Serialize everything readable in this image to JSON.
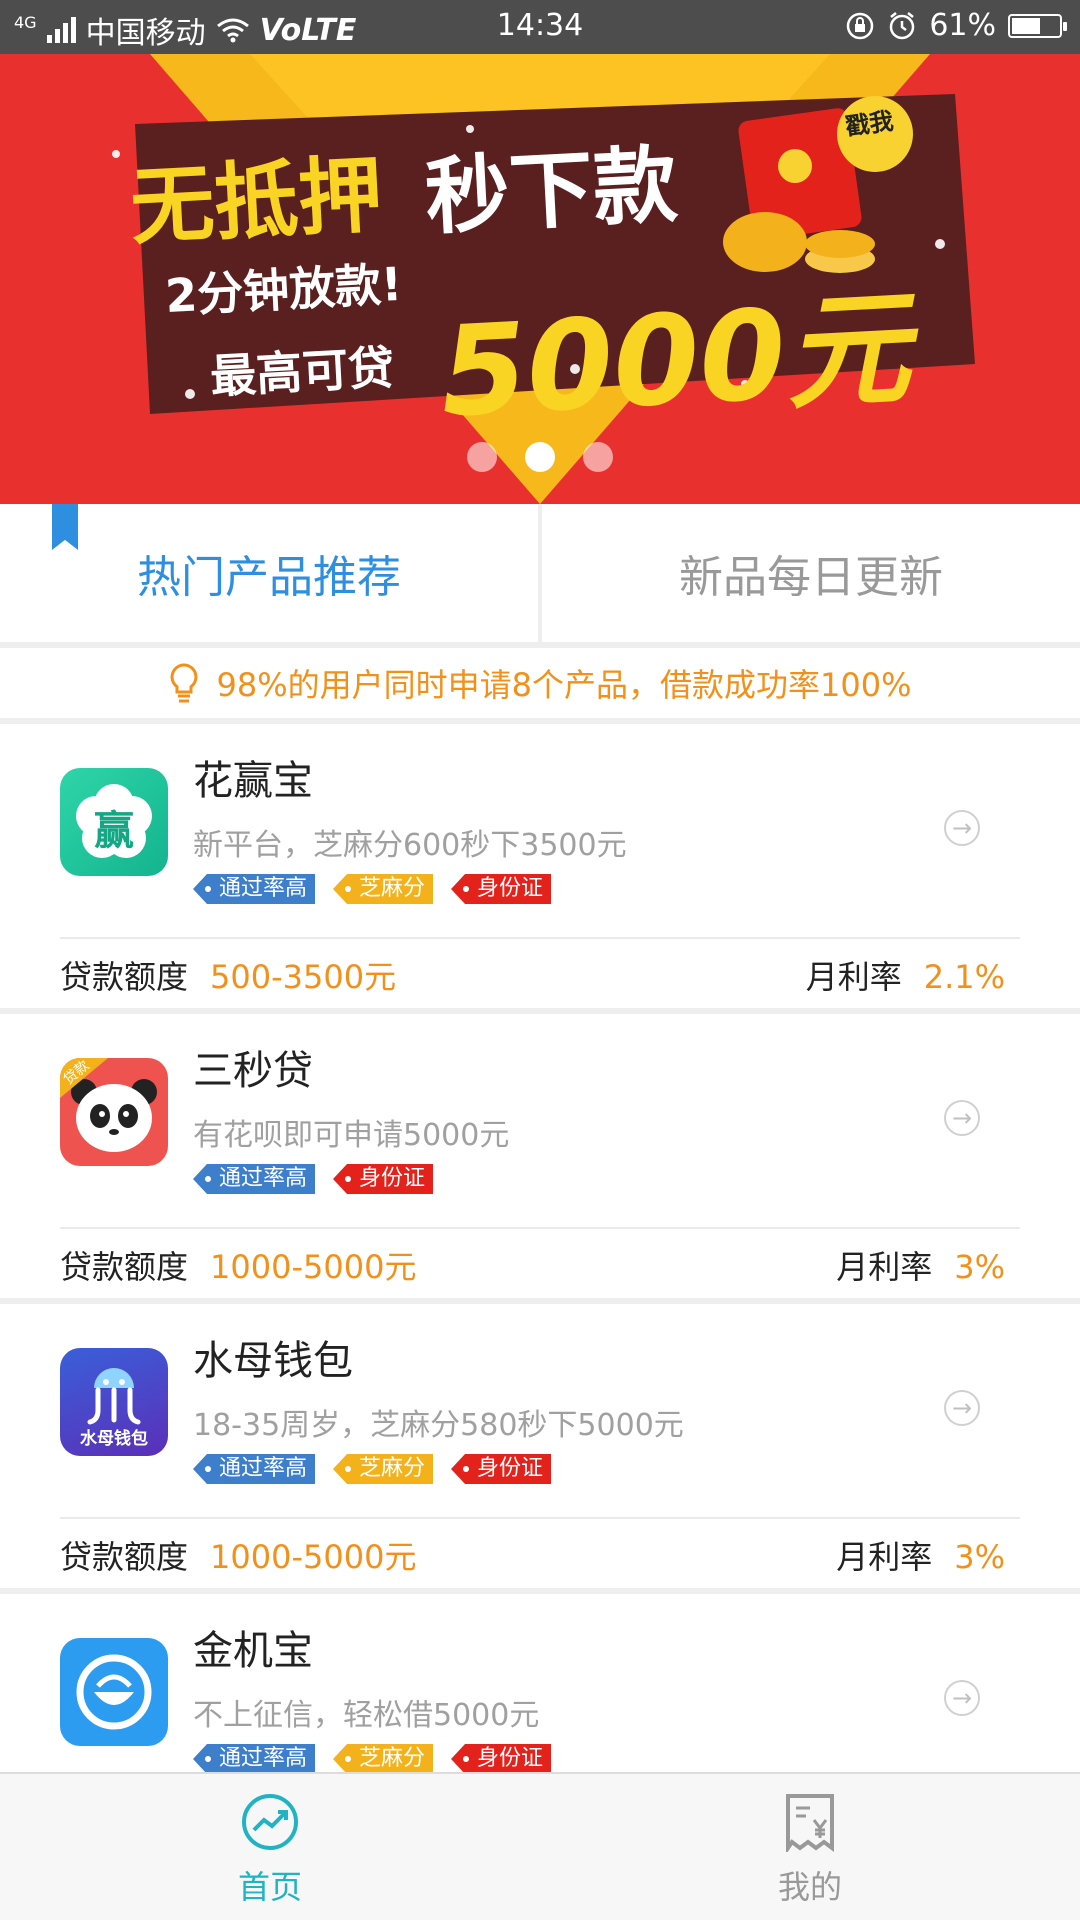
{
  "status_bar": {
    "network": "4G",
    "carrier": "中国移动",
    "volte": "VoLTE",
    "time": "14:34",
    "battery_text": "61%",
    "battery_level": 0.61
  },
  "banner": {
    "headline1": "无抵押",
    "headline2": "秒下款",
    "line_fast": "2分钟放款!",
    "line_max": "最高可贷",
    "amount": "5000元",
    "badge": "戳我",
    "colors": {
      "background": "#e8312f",
      "accent": "#f9d423",
      "panel": "#5a1f1f"
    },
    "slide_count": 3,
    "active_slide": 1
  },
  "tabs": [
    {
      "label": "热门产品推荐",
      "active": true
    },
    {
      "label": "新品每日更新",
      "active": false
    }
  ],
  "notice": {
    "icon": "lightbulb-icon",
    "text": "98%的用户同时申请8个产品，借款成功率100%"
  },
  "labels": {
    "amount": "贷款额度",
    "rate": "月利率"
  },
  "products": [
    {
      "name": "花赢宝",
      "desc": "新平台，芝麻分600秒下3500元",
      "logo_text": "赢",
      "tags": [
        {
          "label": "通过率高",
          "color": "blue"
        },
        {
          "label": "芝麻分",
          "color": "yellow"
        },
        {
          "label": "身份证",
          "color": "red"
        }
      ],
      "amount": "500-3500元",
      "rate": "2.1%"
    },
    {
      "name": "三秒贷",
      "desc": "有花呗即可申请5000元",
      "logo_text": "贷款",
      "tags": [
        {
          "label": "通过率高",
          "color": "blue"
        },
        {
          "label": "身份证",
          "color": "red"
        }
      ],
      "amount": "1000-5000元",
      "rate": "3%"
    },
    {
      "name": "水母钱包",
      "desc": "18-35周岁，芝麻分580秒下5000元",
      "logo_text": "水母钱包",
      "tags": [
        {
          "label": "通过率高",
          "color": "blue"
        },
        {
          "label": "芝麻分",
          "color": "yellow"
        },
        {
          "label": "身份证",
          "color": "red"
        }
      ],
      "amount": "1000-5000元",
      "rate": "3%"
    },
    {
      "name": "金机宝",
      "desc": "不上征信，轻松借5000元",
      "logo_text": "",
      "tags": [
        {
          "label": "通过率高",
          "color": "blue"
        },
        {
          "label": "芝麻分",
          "color": "yellow"
        },
        {
          "label": "身份证",
          "color": "red"
        }
      ],
      "amount": "",
      "rate": ""
    }
  ],
  "bottom_nav": [
    {
      "label": "首页",
      "icon": "chart-trend-icon",
      "active": true
    },
    {
      "label": "我的",
      "icon": "receipt-icon",
      "active": false
    }
  ],
  "colors": {
    "primary_blue": "#2e8fe0",
    "orange": "#f39019",
    "teal": "#1fb3c3"
  }
}
